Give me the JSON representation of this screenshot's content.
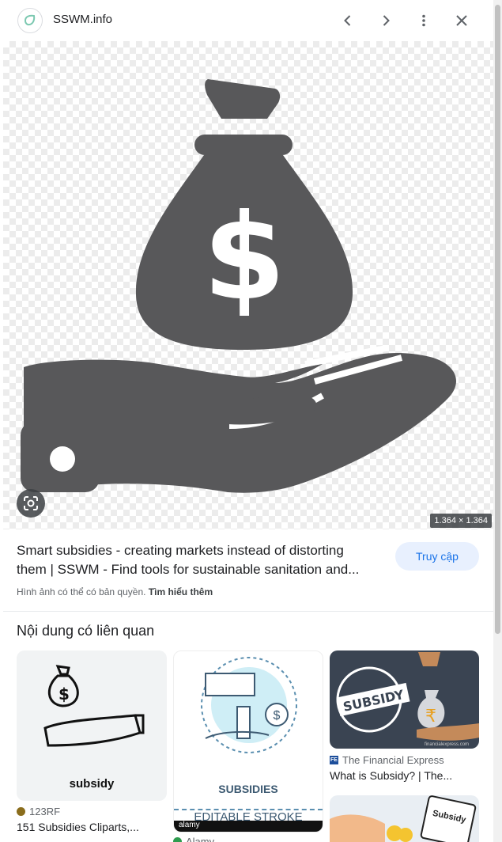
{
  "header": {
    "site_name": "SSWM.info",
    "logo_icon": "sswm-logo-icon",
    "back_icon": "chevron-left-icon",
    "forward_icon": "chevron-right-icon",
    "more_icon": "more-vert-icon",
    "close_icon": "close-icon"
  },
  "preview": {
    "dimensions": "1.364 × 1.364",
    "image_subject": "hand-holding-money-bag-icon",
    "lens_icon": "google-lens-icon"
  },
  "result": {
    "title_line1": "Smart subsidies - creating markets instead of distorting",
    "title_line2": "them | SSWM - Find tools for sustainable sanitation and...",
    "visit_label": "Truy cập",
    "copyright_text": "Hình ảnh có thể có bản quyền.",
    "learn_more": "Tìm hiểu thêm"
  },
  "related": {
    "heading": "Nội dung có liên quan",
    "items": [
      {
        "source": "123RF",
        "title": "151 Subsidies Cliparts,...",
        "image_caption": "subsidy"
      },
      {
        "source": "Alamy",
        "title": "",
        "image_caption": "SUBSIDIES",
        "image_caption2": "EDITABLE STROKE",
        "watermark": "alamy"
      },
      {
        "source": "The Financial Express",
        "title": "What is Subsidy? | The...",
        "image_caption": "SUBSIDY",
        "watermark": "financialexpress.com"
      },
      {
        "source": "",
        "title": "",
        "image_caption": "Subsidy"
      }
    ]
  },
  "colors": {
    "accent": "#1a73e8",
    "visit_bg": "#e8f0fe",
    "icon_dark": "#58585a",
    "source_123rf": "#8a6d1c",
    "source_fe": "#1c4e9b"
  }
}
